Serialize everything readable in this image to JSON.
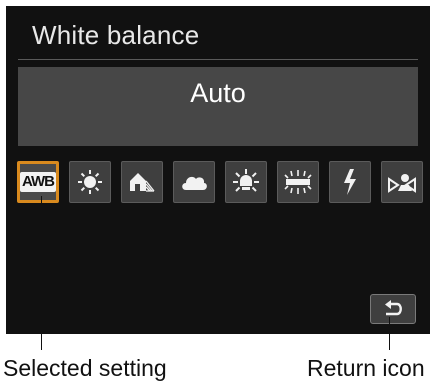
{
  "screen": {
    "title": "White balance",
    "current_value": "Auto",
    "options": [
      {
        "icon": "awb-icon",
        "badge_text": "AWB",
        "selected": true
      },
      {
        "icon": "daylight-icon",
        "selected": false
      },
      {
        "icon": "shade-icon",
        "selected": false
      },
      {
        "icon": "cloudy-icon",
        "selected": false
      },
      {
        "icon": "tungsten-icon",
        "selected": false
      },
      {
        "icon": "fluorescent-icon",
        "selected": false
      },
      {
        "icon": "flash-icon",
        "selected": false
      },
      {
        "icon": "custom-wb-icon",
        "selected": false
      }
    ],
    "return_icon": "return-icon",
    "colors": {
      "background": "#111111",
      "panel": "#474747",
      "selection_border": "#d98a1e",
      "text": "#ffffff"
    }
  },
  "callouts": {
    "selected_setting": "Selected setting",
    "return_icon": "Return icon"
  }
}
